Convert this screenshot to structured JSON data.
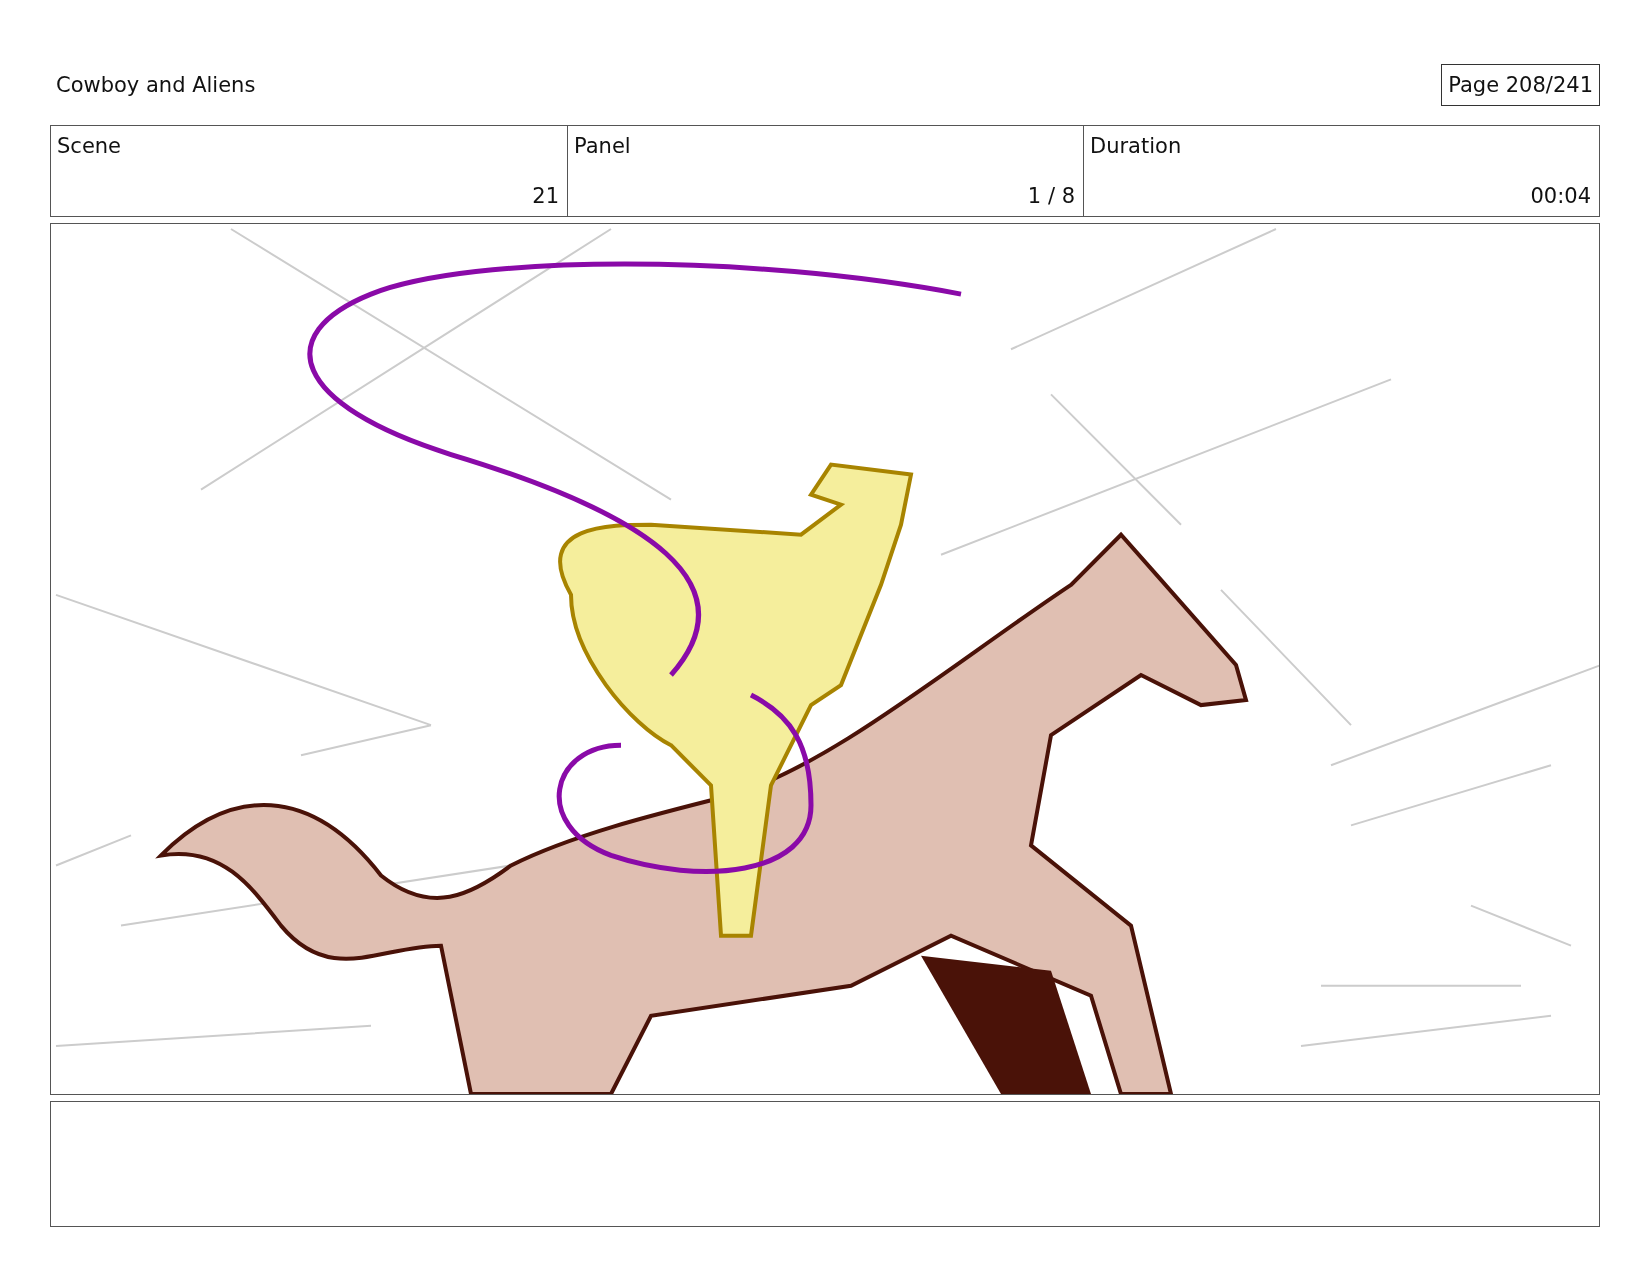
{
  "title": "Cowboy and Aliens",
  "page": "Page 208/241",
  "info_table": {
    "columns": [
      "Scene",
      "Panel",
      "Duration"
    ],
    "values": [
      "21",
      "1 / 8",
      "00:04"
    ]
  }
}
